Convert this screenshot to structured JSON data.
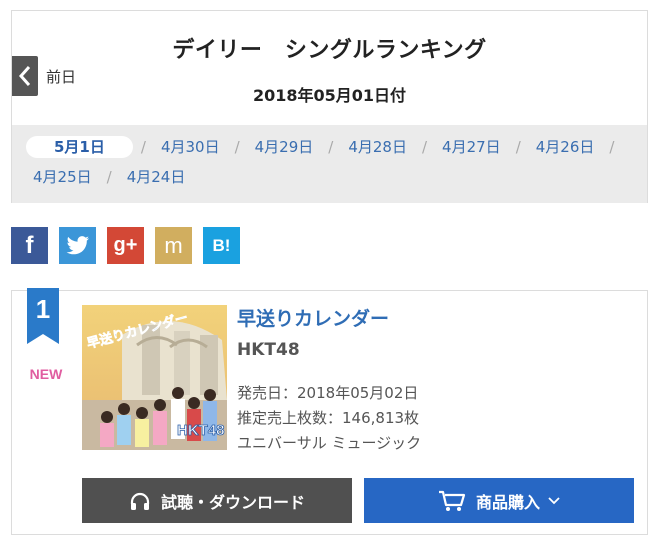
{
  "header": {
    "prev_label": "前日",
    "title": "デイリー　シングルランキング",
    "date": "2018年05月01日付"
  },
  "dates": [
    "5月1日",
    "4月30日",
    "4月29日",
    "4月28日",
    "4月27日",
    "4月26日",
    "4月25日",
    "4月24日"
  ],
  "share": {
    "facebook": "f",
    "twitter": "twitter-bird-icon",
    "googleplus": "g+",
    "mixi": "m",
    "hatena": "B!"
  },
  "ranking": {
    "rank": "1",
    "tag": "NEW",
    "title": "早送りカレンダー",
    "artist": "HKT48",
    "release_key": "発売日：",
    "release_val": "2018年05月02日",
    "sales_key": "推定売上枚数：",
    "sales_val": "146,813枚",
    "label": "ユニバーサル ミュージック",
    "jacket_text": "早送りカレンダー",
    "jacket_logo": "HKT48"
  },
  "buttons": {
    "listen": "試聴・ダウンロード",
    "buy": "商品購入"
  },
  "colors": {
    "link_blue": "#3a6eb0",
    "buy_blue": "#2767c4",
    "badge_blue": "#2a7ac9",
    "new_pink": "#e05da0"
  }
}
